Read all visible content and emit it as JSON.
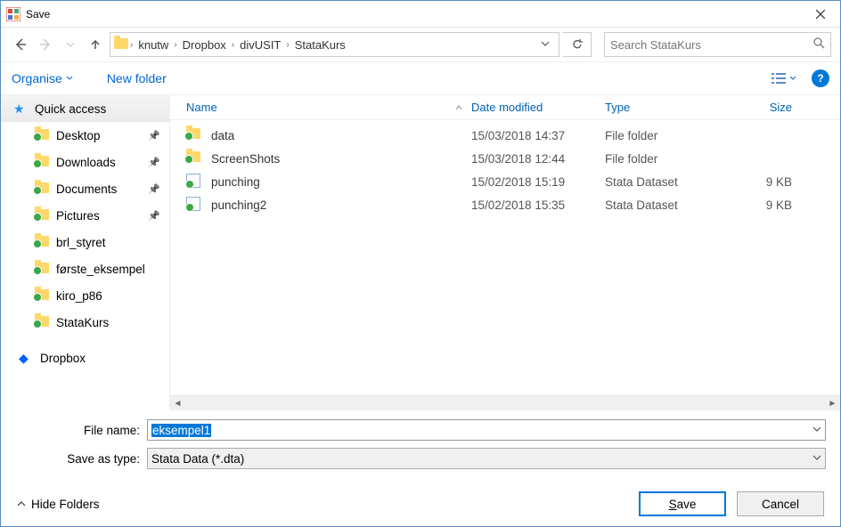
{
  "window": {
    "title": "Save"
  },
  "breadcrumbs": [
    "knutw",
    "Dropbox",
    "divUSIT",
    "StataKurs"
  ],
  "search": {
    "placeholder": "Search StataKurs"
  },
  "toolbar": {
    "organise": "Organise",
    "newfolder": "New folder"
  },
  "sidebar": {
    "quick_access": "Quick access",
    "items": [
      {
        "label": "Desktop",
        "pinned": true
      },
      {
        "label": "Downloads",
        "pinned": true
      },
      {
        "label": "Documents",
        "pinned": true
      },
      {
        "label": "Pictures",
        "pinned": true
      },
      {
        "label": "brl_styret",
        "pinned": false
      },
      {
        "label": "første_eksempel",
        "pinned": false
      },
      {
        "label": "kiro_p86",
        "pinned": false
      },
      {
        "label": "StataKurs",
        "pinned": false
      }
    ],
    "dropbox": "Dropbox"
  },
  "columns": {
    "name": "Name",
    "date": "Date modified",
    "type": "Type",
    "size": "Size"
  },
  "files": [
    {
      "name": "data",
      "date": "15/03/2018 14:37",
      "type": "File folder",
      "size": "",
      "icon": "folder"
    },
    {
      "name": "ScreenShots",
      "date": "15/03/2018 12:44",
      "type": "File folder",
      "size": "",
      "icon": "folder"
    },
    {
      "name": "punching",
      "date": "15/02/2018 15:19",
      "type": "Stata Dataset",
      "size": "9 KB",
      "icon": "stata"
    },
    {
      "name": "punching2",
      "date": "15/02/2018 15:35",
      "type": "Stata Dataset",
      "size": "9 KB",
      "icon": "stata"
    }
  ],
  "form": {
    "filename_label": "File name:",
    "filename_value": "eksempel1",
    "saveas_label": "Save as type:",
    "saveas_value": "Stata Data (*.dta)"
  },
  "bottom": {
    "hide_folders": "Hide Folders",
    "save": "Save",
    "cancel": "Cancel"
  }
}
